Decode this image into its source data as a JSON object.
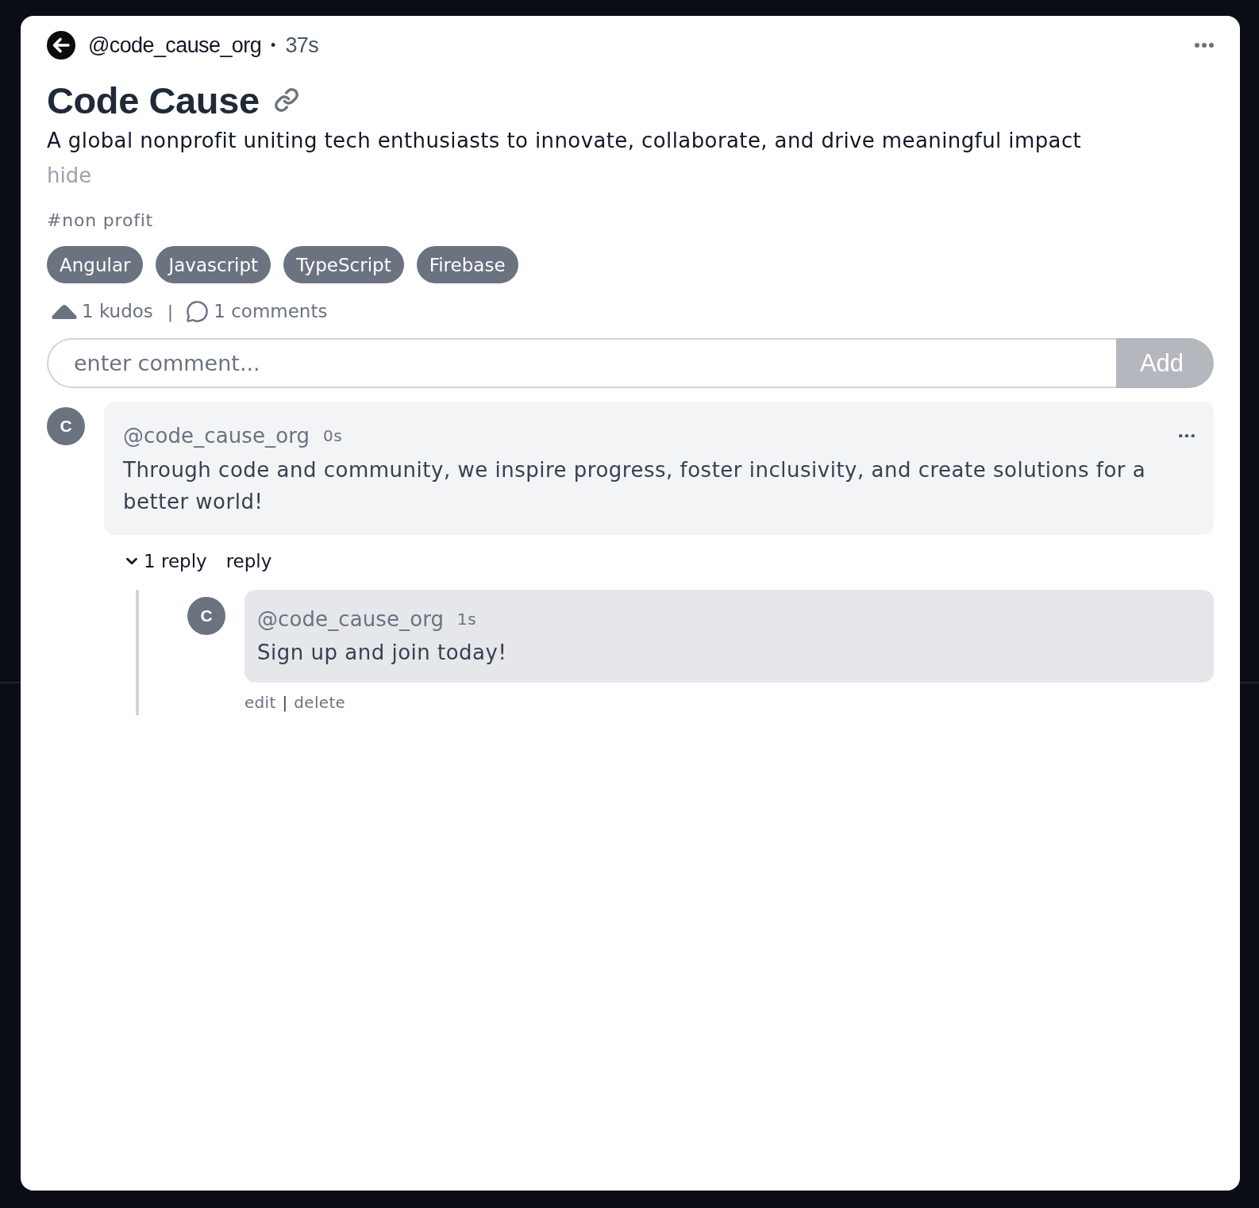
{
  "post": {
    "author": "@code_cause_org",
    "separator": "•",
    "time": "37s",
    "title": "Code Cause",
    "description": "A global nonprofit uniting tech enthusiasts to innovate, collaborate, and drive meaningful impact",
    "hide_link": "hide",
    "hashtag": "#non profit",
    "tags": [
      "Angular",
      "Javascript",
      "TypeScript",
      "Firebase"
    ]
  },
  "stats": {
    "kudos": "1 kudos",
    "separator": "|",
    "comments": "1 comments"
  },
  "comment_form": {
    "placeholder": "enter comment...",
    "add_button": {
      "label": "Add",
      "disabled": true
    }
  },
  "comments": [
    {
      "avatar": "C",
      "author": "@code_cause_org",
      "time": "0s",
      "text": "Through code and community, we inspire progress, foster inclusivity, and create solutions for a better world!",
      "replies_toggle": {
        "label": "1 reply",
        "expanded": true
      },
      "reply_link": "reply",
      "replies": [
        {
          "avatar": "C",
          "author": "@code_cause_org",
          "time": "1s",
          "text": "Sign up and join today!",
          "actions": [
            "edit",
            "delete"
          ],
          "action_separator": "|"
        }
      ]
    }
  ]
}
